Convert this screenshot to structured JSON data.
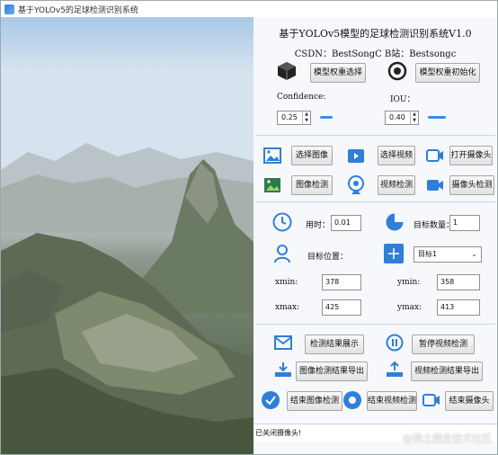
{
  "window": {
    "title": "基于YOLOv5的足球检测识别系统"
  },
  "header": {
    "title": "基于YOLOv5模型的足球检测识别系统V1.0",
    "csdn": "CSDN：BestSongC  B站：Bestsongc"
  },
  "model": {
    "select_label": "模型权重选择",
    "init_label": "模型权重初始化",
    "confidence_label": "Confidence:",
    "confidence_value": "0.25",
    "iou_label": "IOU：",
    "iou_value": "0.40"
  },
  "actions": {
    "select_image": "选择图像",
    "select_video": "选择视频",
    "open_camera": "打开摄像头",
    "image_detect": "图像检测",
    "video_detect": "视频检测",
    "camera_detect": "摄像头检测"
  },
  "results": {
    "time_label": "用时：",
    "time_value": "0.01",
    "count_label": "目标数量：",
    "count_value": "1",
    "position_label": "目标位置：",
    "target_select": "目标1",
    "xmin_label": "xmin:",
    "xmin_value": "378",
    "ymin_label": "ymin:",
    "ymin_value": "358",
    "xmax_label": "xmax:",
    "xmax_value": "425",
    "ymax_label": "ymax:",
    "ymax_value": "413"
  },
  "bottom": {
    "show_results": "检测结果展示",
    "pause_video": "暂停视频检测",
    "export_image": "图像检测结果导出",
    "export_video": "视频检测结果导出",
    "end_image": "结束图像检测",
    "end_video": "结束视频检测",
    "end_camera": "结束摄像头"
  },
  "status": {
    "message": "已关闭摄像头!"
  },
  "watermark": "@稀土掘金技术社区",
  "colors": {
    "accent": "#3d8be8",
    "icon_blue": "#2f7fd8"
  }
}
